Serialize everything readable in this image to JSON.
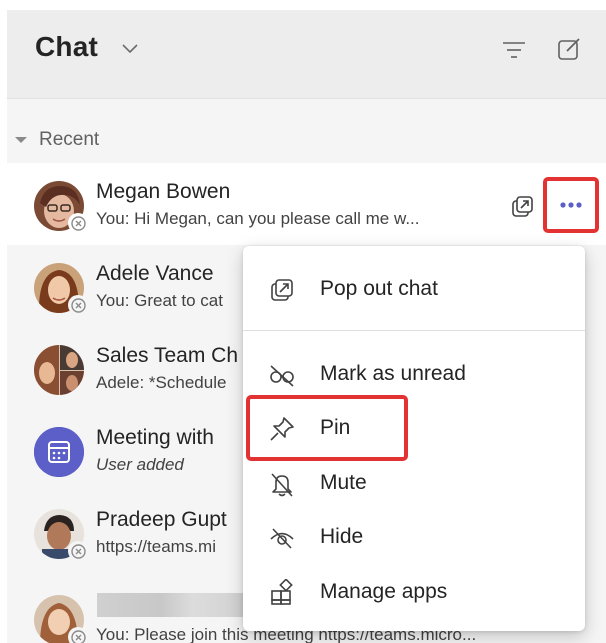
{
  "header": {
    "title": "Chat"
  },
  "sections": {
    "recent_label": "Recent"
  },
  "chats": [
    {
      "name": "Megan Bowen",
      "preview": "You: Hi Megan, can you please call me w..."
    },
    {
      "name": "Adele Vance",
      "preview": "You: Great to cat"
    },
    {
      "name": "Sales Team Ch",
      "preview": "Adele: *Schedule"
    },
    {
      "name": "Meeting with",
      "preview": "User added"
    },
    {
      "name": "Pradeep Gupt",
      "preview": "https://teams.mi"
    },
    {
      "name": "",
      "preview": "You: Please join this meeting https://teams.micro..."
    }
  ],
  "context_menu": {
    "items": [
      {
        "label": "Pop out chat",
        "icon": "popout-icon"
      },
      {
        "label": "Mark as unread",
        "icon": "mark-unread-icon"
      },
      {
        "label": "Pin",
        "icon": "pin-icon"
      },
      {
        "label": "Mute",
        "icon": "mute-bell-icon"
      },
      {
        "label": "Hide",
        "icon": "hide-eye-icon"
      },
      {
        "label": "Manage apps",
        "icon": "manage-apps-icon"
      }
    ]
  },
  "colors": {
    "highlight": "#e23232",
    "accent": "#5b5fc7"
  }
}
